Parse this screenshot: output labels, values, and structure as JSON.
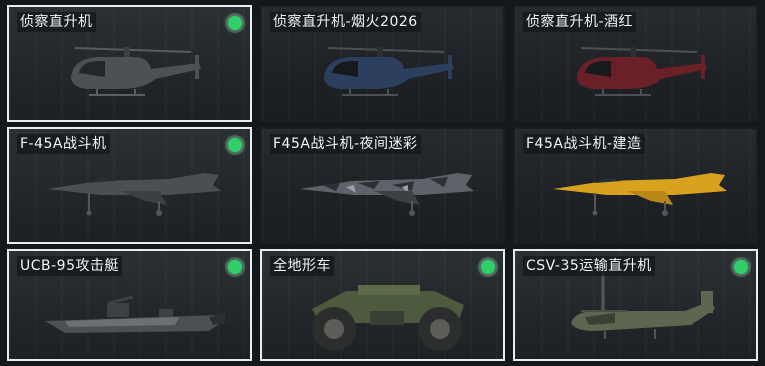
{
  "vehicles": [
    {
      "name": "侦察直升机",
      "equipped": true,
      "icon": "scout-helicopter"
    },
    {
      "name": "侦察直升机-烟火2026",
      "equipped": false,
      "icon": "scout-helicopter-fireworks"
    },
    {
      "name": "侦察直升机-酒红",
      "equipped": false,
      "icon": "scout-helicopter-wine-red"
    },
    {
      "name": "F-45A战斗机",
      "equipped": true,
      "icon": "fighter-jet"
    },
    {
      "name": "F45A战斗机-夜间迷彩",
      "equipped": false,
      "icon": "fighter-jet-night-camo"
    },
    {
      "name": "F45A战斗机-建造",
      "equipped": false,
      "icon": "fighter-jet-construction"
    },
    {
      "name": "UCB-95攻击艇",
      "equipped": true,
      "icon": "attack-boat"
    },
    {
      "name": "全地形车",
      "equipped": true,
      "icon": "atv"
    },
    {
      "name": "CSV-35运输直升机",
      "equipped": true,
      "icon": "transport-tiltrotor"
    }
  ],
  "colors": {
    "equipped_indicator": "#2fd06a",
    "selected_border": "#e9ecef",
    "fireworks_accent": "#2c3f5e",
    "wine_red_accent": "#6b1f27",
    "construction_accent": "#d9a21e"
  }
}
